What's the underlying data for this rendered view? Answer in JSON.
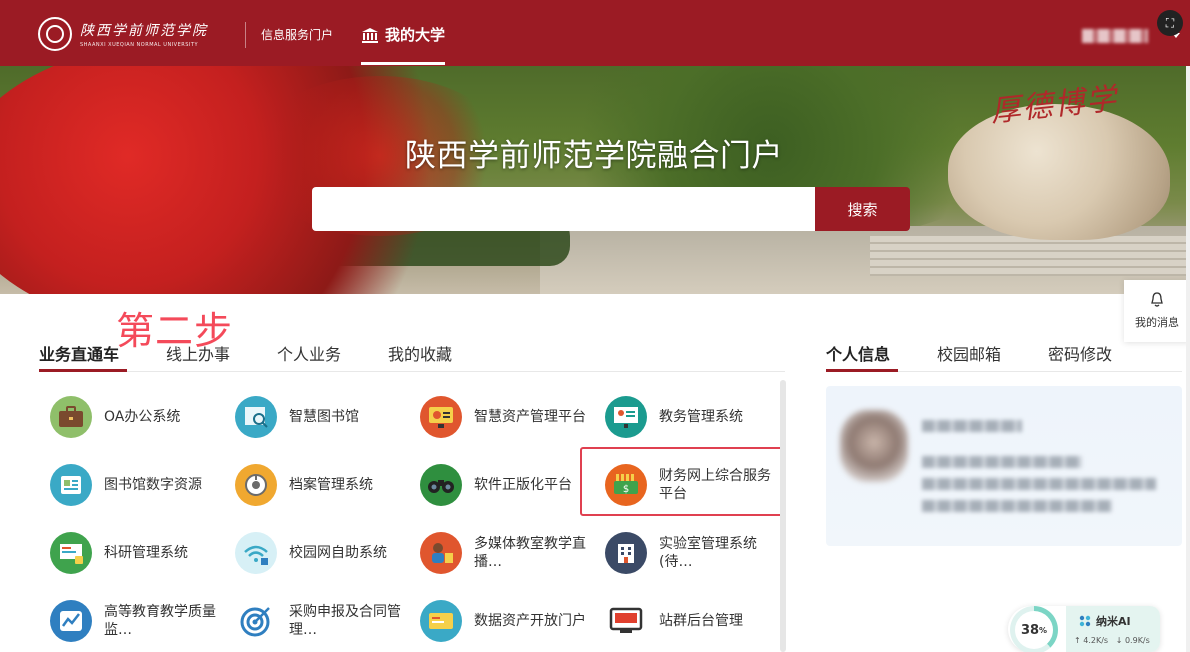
{
  "header": {
    "logo_cn": "陕西学前师范学院",
    "logo_en": "SHAANXI XUEQIAN NORMAL UNIVERSITY",
    "nav_portal": "信息服务门户",
    "nav_my_university": "我的大学",
    "bank_icon": "bank-icon",
    "screenshot_icon": "⛶"
  },
  "banner": {
    "title": "陕西学前师范学院融合门户",
    "search_placeholder": "",
    "search_button": "搜索",
    "rock_inscription": "厚德博学"
  },
  "annotation": {
    "step_text": "第二步",
    "color": "#f44a5a"
  },
  "left_tabs": [
    {
      "label": "业务直通车",
      "active": true
    },
    {
      "label": "线上办事",
      "active": false
    },
    {
      "label": "个人业务",
      "active": false
    },
    {
      "label": "我的收藏",
      "active": false
    }
  ],
  "apps": [
    {
      "label": "OA办公系统",
      "icon": "briefcase-icon"
    },
    {
      "label": "智慧图书馆",
      "icon": "library-search-icon"
    },
    {
      "label": "智慧资产管理平台",
      "icon": "asset-monitor-icon"
    },
    {
      "label": "教务管理系统",
      "icon": "teaching-board-icon"
    },
    {
      "label": "图书馆数字资源",
      "icon": "digital-resource-icon"
    },
    {
      "label": "档案管理系统",
      "icon": "archive-dial-icon"
    },
    {
      "label": "软件正版化平台",
      "icon": "binoculars-icon"
    },
    {
      "label": "财务网上综合服务平台",
      "icon": "finance-money-icon"
    },
    {
      "label": "科研管理系统",
      "icon": "research-screen-icon"
    },
    {
      "label": "校园网自助系统",
      "icon": "wifi-self-service-icon"
    },
    {
      "label": "多媒体教室教学直播…",
      "icon": "live-teaching-icon"
    },
    {
      "label": "实验室管理系统(待…",
      "icon": "lab-building-icon"
    },
    {
      "label": "高等教育教学质量监…",
      "icon": "quality-chart-icon"
    },
    {
      "label": "采购申报及合同管理…",
      "icon": "target-arrow-icon"
    },
    {
      "label": "数据资产开放门户",
      "icon": "data-card-icon"
    },
    {
      "label": "站群后台管理",
      "icon": "site-admin-icon"
    }
  ],
  "right_tabs": [
    {
      "label": "个人信息",
      "active": true
    },
    {
      "label": "校园邮箱",
      "active": false
    },
    {
      "label": "密码修改",
      "active": false
    }
  ],
  "messages": {
    "label": "我的消息"
  },
  "net_widget": {
    "percent": "38",
    "percent_unit": "%",
    "brand": "纳米AI",
    "upload": "↑ 4.2K/s",
    "download": "↓ 0.9K/s"
  },
  "colors": {
    "brand": "#9b1b24",
    "highlight": "#e04050"
  }
}
